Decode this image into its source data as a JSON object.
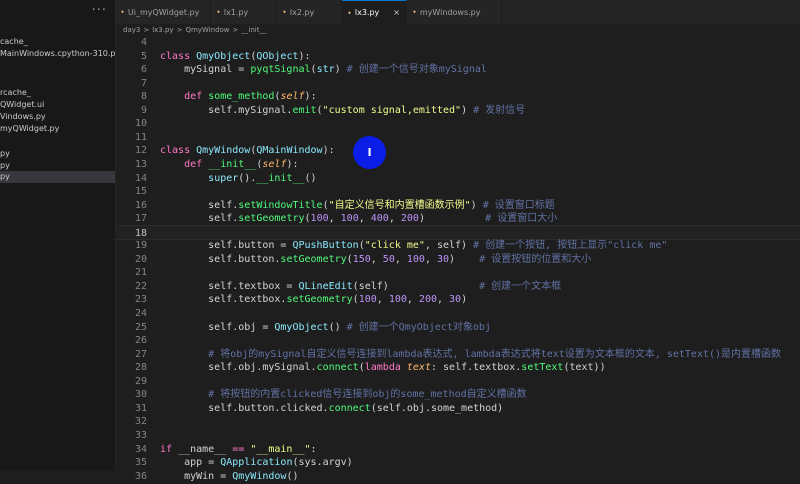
{
  "sidebar": {
    "dots": "···",
    "items": [
      {
        "label": "cache_",
        "selected": false
      },
      {
        "label": "MainWindows.cpython-310.pyc",
        "selected": false
      },
      {
        "label": "rcache_",
        "selected": false
      },
      {
        "label": "QWidget.ui",
        "selected": false
      },
      {
        "label": "Vindows.py",
        "selected": false
      },
      {
        "label": "myQWidget.py",
        "selected": false
      },
      {
        "label": "py",
        "selected": false
      },
      {
        "label": "py",
        "selected": false
      },
      {
        "label": "py",
        "selected": true
      }
    ]
  },
  "tabs": [
    {
      "label": "Ui_myQWidget.py",
      "active": false,
      "close": ""
    },
    {
      "label": "lx1.py",
      "active": false,
      "close": ""
    },
    {
      "label": "lx2.py",
      "active": false,
      "close": ""
    },
    {
      "label": "lx3.py",
      "active": true,
      "close": "×"
    },
    {
      "label": "myWindows.py",
      "active": false,
      "close": ""
    }
  ],
  "breadcrumb": [
    "day3",
    ">",
    "lx3.py",
    ">",
    "QmyWindow",
    ">",
    "__init__"
  ],
  "code": [
    {
      "n": "4",
      "t": [],
      "cur": false
    },
    {
      "n": "5",
      "t": [
        [
          "k",
          "class "
        ],
        [
          "c",
          "QmyObject"
        ],
        [
          "d",
          "("
        ],
        [
          "c",
          "QObject"
        ],
        [
          "d",
          "):"
        ]
      ],
      "cur": false
    },
    {
      "n": "6",
      "t": [
        [
          "d",
          "    mySignal = "
        ],
        [
          "f",
          "pyqtSignal"
        ],
        [
          "d",
          "("
        ],
        [
          "c",
          "str"
        ],
        [
          "d",
          ") "
        ],
        [
          "cm",
          "# 创建一个信号对象mySignal"
        ]
      ],
      "cur": false
    },
    {
      "n": "7",
      "t": [],
      "cur": false
    },
    {
      "n": "8",
      "t": [
        [
          "d",
          "    "
        ],
        [
          "k",
          "def "
        ],
        [
          "f",
          "some_method"
        ],
        [
          "d",
          "("
        ],
        [
          "p",
          "self"
        ],
        [
          "d",
          "):"
        ]
      ],
      "cur": false
    },
    {
      "n": "9",
      "t": [
        [
          "d",
          "        self.mySignal."
        ],
        [
          "f",
          "emit"
        ],
        [
          "d",
          "("
        ],
        [
          "s",
          "\"custom signal,emitted\""
        ],
        [
          "d",
          ") "
        ],
        [
          "cm",
          "# 发射信号"
        ]
      ],
      "cur": false
    },
    {
      "n": "10",
      "t": [],
      "cur": false
    },
    {
      "n": "11",
      "t": [],
      "cur": false
    },
    {
      "n": "12",
      "t": [
        [
          "k",
          "class "
        ],
        [
          "c",
          "QmyWindow"
        ],
        [
          "d",
          "("
        ],
        [
          "c",
          "QMainWindow"
        ],
        [
          "d",
          "):"
        ]
      ],
      "cur": false
    },
    {
      "n": "13",
      "t": [
        [
          "d",
          "    "
        ],
        [
          "k",
          "def "
        ],
        [
          "f",
          "__init__"
        ],
        [
          "d",
          "("
        ],
        [
          "p",
          "self"
        ],
        [
          "d",
          "):"
        ]
      ],
      "cur": false
    },
    {
      "n": "14",
      "t": [
        [
          "d",
          "        "
        ],
        [
          "c",
          "super"
        ],
        [
          "d",
          "()."
        ],
        [
          "f",
          "__init__"
        ],
        [
          "d",
          "()"
        ]
      ],
      "cur": false
    },
    {
      "n": "15",
      "t": [],
      "cur": false
    },
    {
      "n": "16",
      "t": [
        [
          "d",
          "        self."
        ],
        [
          "f",
          "setWindowTitle"
        ],
        [
          "d",
          "("
        ],
        [
          "s",
          "\"自定义信号和内置槽函数示例\""
        ],
        [
          "d",
          ") "
        ],
        [
          "cm",
          "# 设置窗口标题"
        ]
      ],
      "cur": false
    },
    {
      "n": "17",
      "t": [
        [
          "d",
          "        self."
        ],
        [
          "f",
          "setGeometry"
        ],
        [
          "d",
          "("
        ],
        [
          "n",
          "100"
        ],
        [
          "d",
          ", "
        ],
        [
          "n",
          "100"
        ],
        [
          "d",
          ", "
        ],
        [
          "n",
          "400"
        ],
        [
          "d",
          ", "
        ],
        [
          "n",
          "200"
        ],
        [
          "d",
          ")          "
        ],
        [
          "cm",
          "# 设置窗口大小"
        ]
      ],
      "cur": false
    },
    {
      "n": "18",
      "t": [],
      "cur": true
    },
    {
      "n": "19",
      "t": [
        [
          "d",
          "        self.button = "
        ],
        [
          "c",
          "QPushButton"
        ],
        [
          "d",
          "("
        ],
        [
          "s",
          "\"click me\""
        ],
        [
          "d",
          ", self) "
        ],
        [
          "cm",
          "# 创建一个按钮, 按钮上显示\"click me\""
        ]
      ],
      "cur": false
    },
    {
      "n": "20",
      "t": [
        [
          "d",
          "        self.button."
        ],
        [
          "f",
          "setGeometry"
        ],
        [
          "d",
          "("
        ],
        [
          "n",
          "150"
        ],
        [
          "d",
          ", "
        ],
        [
          "n",
          "50"
        ],
        [
          "d",
          ", "
        ],
        [
          "n",
          "100"
        ],
        [
          "d",
          ", "
        ],
        [
          "n",
          "30"
        ],
        [
          "d",
          ")    "
        ],
        [
          "cm",
          "# 设置按钮的位置和大小"
        ]
      ],
      "cur": false
    },
    {
      "n": "21",
      "t": [],
      "cur": false
    },
    {
      "n": "22",
      "t": [
        [
          "d",
          "        self.textbox = "
        ],
        [
          "c",
          "QLineEdit"
        ],
        [
          "d",
          "(self)               "
        ],
        [
          "cm",
          "# 创建一个文本框"
        ]
      ],
      "cur": false
    },
    {
      "n": "23",
      "t": [
        [
          "d",
          "        self.textbox."
        ],
        [
          "f",
          "setGeometry"
        ],
        [
          "d",
          "("
        ],
        [
          "n",
          "100"
        ],
        [
          "d",
          ", "
        ],
        [
          "n",
          "100"
        ],
        [
          "d",
          ", "
        ],
        [
          "n",
          "200"
        ],
        [
          "d",
          ", "
        ],
        [
          "n",
          "30"
        ],
        [
          "d",
          ")"
        ]
      ],
      "cur": false
    },
    {
      "n": "24",
      "t": [],
      "cur": false
    },
    {
      "n": "25",
      "t": [
        [
          "d",
          "        self.obj = "
        ],
        [
          "c",
          "QmyObject"
        ],
        [
          "d",
          "() "
        ],
        [
          "cm",
          "# 创建一个QmyObject对象obj"
        ]
      ],
      "cur": false
    },
    {
      "n": "26",
      "t": [],
      "cur": false
    },
    {
      "n": "27",
      "t": [
        [
          "d",
          "        "
        ],
        [
          "cm",
          "# 将obj的mySignal自定义信号连接到lambda表达式, lambda表达式将text设置为文本框的文本, setText()是内置槽函数"
        ]
      ],
      "cur": false
    },
    {
      "n": "28",
      "t": [
        [
          "d",
          "        self.obj.mySignal."
        ],
        [
          "f",
          "connect"
        ],
        [
          "d",
          "("
        ],
        [
          "k",
          "lambda "
        ],
        [
          "p",
          "text"
        ],
        [
          "d",
          ": self.textbox."
        ],
        [
          "f",
          "setText"
        ],
        [
          "d",
          "(text))"
        ]
      ],
      "cur": false
    },
    {
      "n": "29",
      "t": [],
      "cur": false
    },
    {
      "n": "30",
      "t": [
        [
          "d",
          "        "
        ],
        [
          "cm",
          "# 将按钮的内置clicked信号连接到obj的some_method自定义槽函数"
        ]
      ],
      "cur": false
    },
    {
      "n": "31",
      "t": [
        [
          "d",
          "        self.button.clicked."
        ],
        [
          "f",
          "connect"
        ],
        [
          "d",
          "(self.obj.some_method)"
        ]
      ],
      "cur": false
    },
    {
      "n": "32",
      "t": [],
      "cur": false
    },
    {
      "n": "33",
      "t": [],
      "cur": false
    },
    {
      "n": "34",
      "t": [
        [
          "k",
          "if "
        ],
        [
          "d",
          "__name__ "
        ],
        [
          "k",
          "== "
        ],
        [
          "s",
          "\"__main__\""
        ],
        [
          "d",
          ":"
        ]
      ],
      "cur": false
    },
    {
      "n": "35",
      "t": [
        [
          "d",
          "    app = "
        ],
        [
          "c",
          "QApplication"
        ],
        [
          "d",
          "(sys.argv)"
        ]
      ],
      "cur": false
    },
    {
      "n": "36",
      "t": [
        [
          "d",
          "    myWin = "
        ],
        [
          "c",
          "QmyWindow"
        ],
        [
          "d",
          "()"
        ]
      ],
      "cur": false
    }
  ],
  "cursor_indicator": {
    "label": "I",
    "color": "#0b1ee8"
  }
}
